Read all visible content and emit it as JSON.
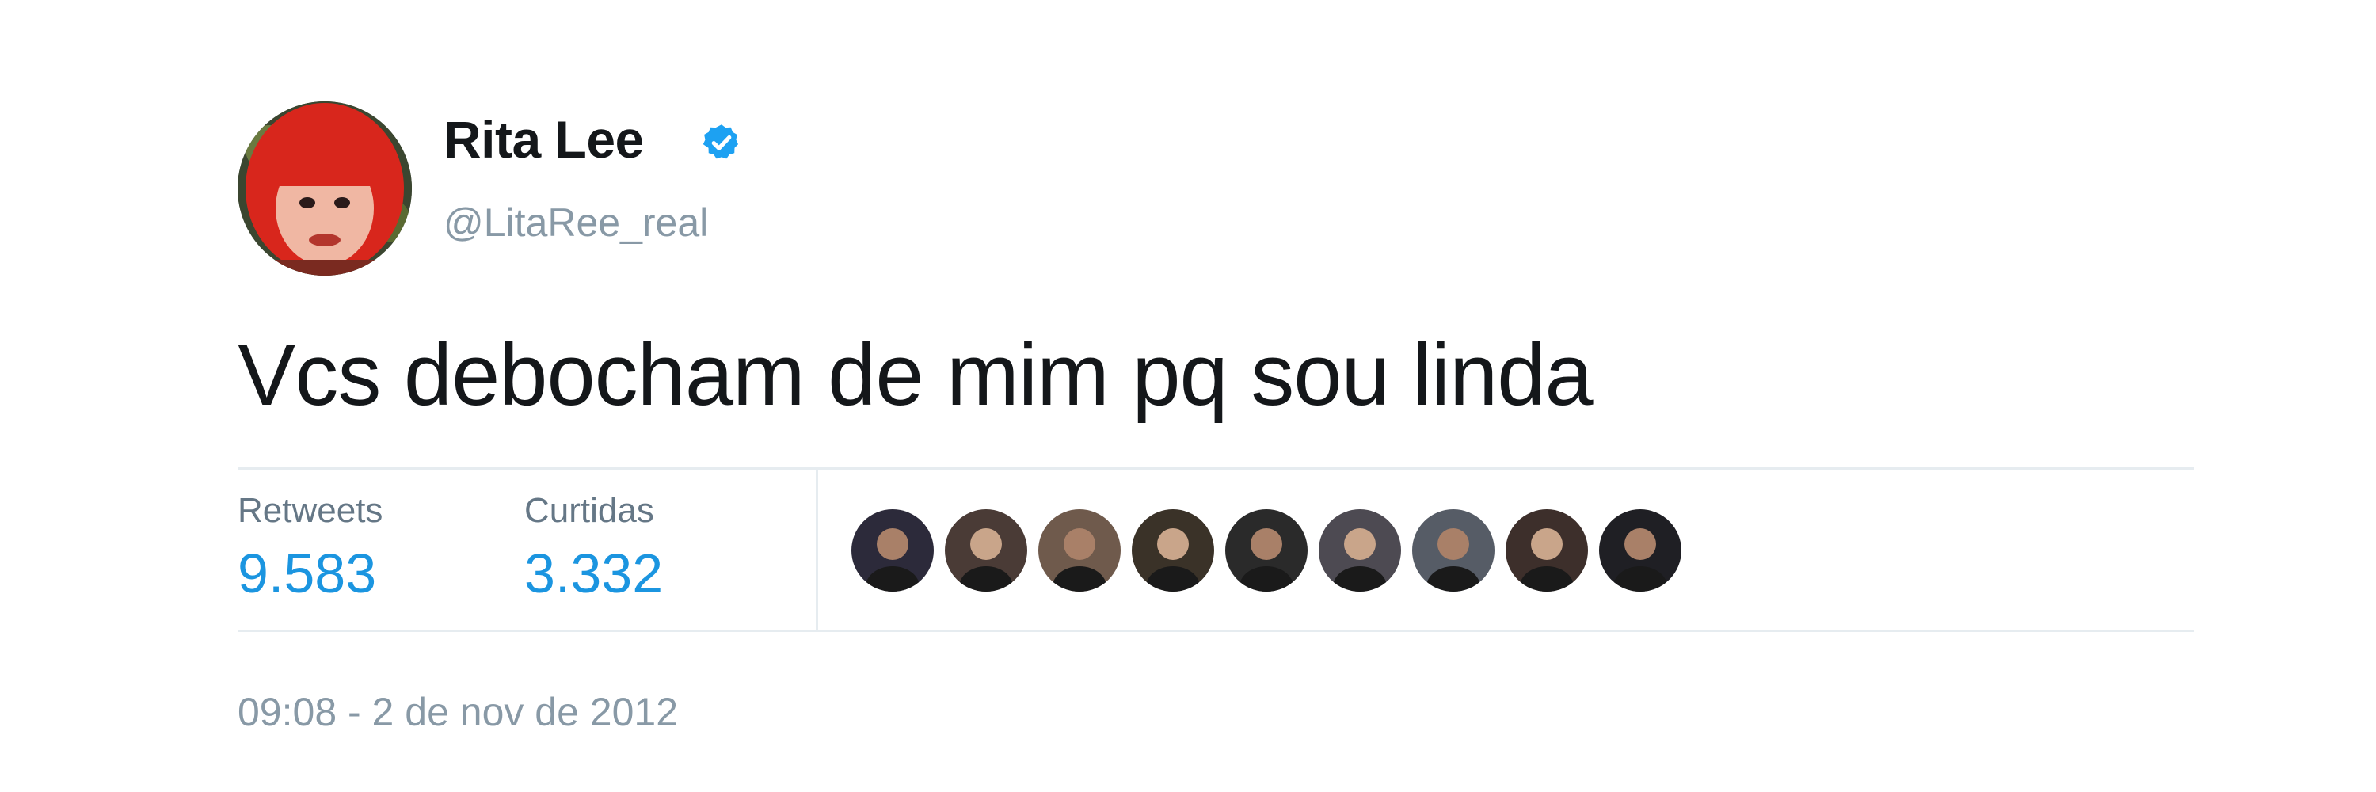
{
  "author": {
    "name": "Rita Lee",
    "handle": "@LitaRee_real",
    "verified": true,
    "avatar_icon": "profile-avatar-red-hair"
  },
  "tweet": {
    "text": "Vcs debocham de mim pq sou linda"
  },
  "stats": {
    "retweets_label": "Retweets",
    "retweets_count": "9.583",
    "likes_label": "Curtidas",
    "likes_count": "3.332"
  },
  "likers": [
    {
      "icon": "user-avatar-icon",
      "color": "#2c2a3a"
    },
    {
      "icon": "user-avatar-icon",
      "color": "#4a3b36"
    },
    {
      "icon": "user-avatar-icon",
      "color": "#6f5a4c"
    },
    {
      "icon": "user-avatar-icon",
      "color": "#3a3228"
    },
    {
      "icon": "user-avatar-icon",
      "color": "#2a2a2a"
    },
    {
      "icon": "user-avatar-icon",
      "color": "#4d4a52"
    },
    {
      "icon": "user-avatar-icon",
      "color": "#565c66"
    },
    {
      "icon": "user-avatar-icon",
      "color": "#3d2f2b"
    },
    {
      "icon": "user-avatar-icon",
      "color": "#1f1f24"
    }
  ],
  "timestamp": "09:08 - 2 de nov de 2012",
  "colors": {
    "link_blue": "#1b95e0",
    "verified_blue": "#1da1f2",
    "muted_gray": "#8899a6",
    "text_dark": "#14171a"
  }
}
